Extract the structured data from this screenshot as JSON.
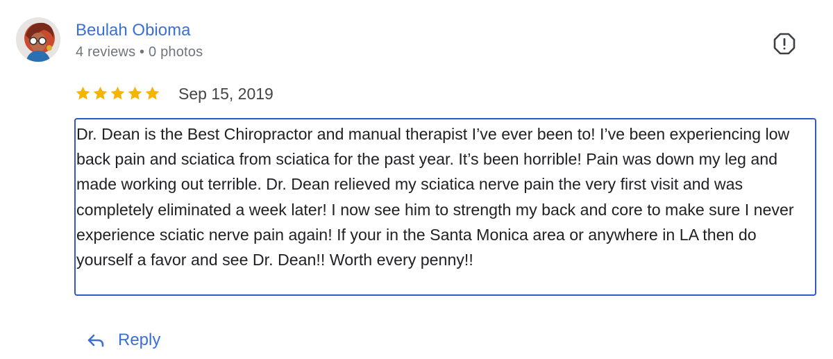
{
  "author": {
    "name": "Beulah Obioma",
    "meta": "4 reviews • 0 photos",
    "avatar_icon": "user-avatar"
  },
  "review": {
    "rating": 5,
    "rating_max": 5,
    "star_color": "#f4b400",
    "date": "Sep 15, 2019",
    "text": "Dr. Dean is the Best Chiropractor and manual therapist I’ve ever been to! I’ve been experiencing low back pain and sciatica from sciatica for the past year. It’s been horrible! Pain was down my leg and made working out terrible. Dr. Dean relieved my sciatica nerve pain the very first visit and was completely eliminated a week later! I now see him to strength my back and core to make sure I never experience sciatic nerve pain again! If your in the Santa Monica area or anywhere in LA then do yourself a favor and see Dr. Dean!! Worth every penny!!"
  },
  "actions": {
    "flag_icon": "report-flag-icon",
    "reply_icon": "reply-arrow-icon",
    "reply_label": "Reply"
  },
  "colors": {
    "accent": "#3a6fd8",
    "focus_border": "#2f58c7",
    "meta_text": "#70757a"
  }
}
